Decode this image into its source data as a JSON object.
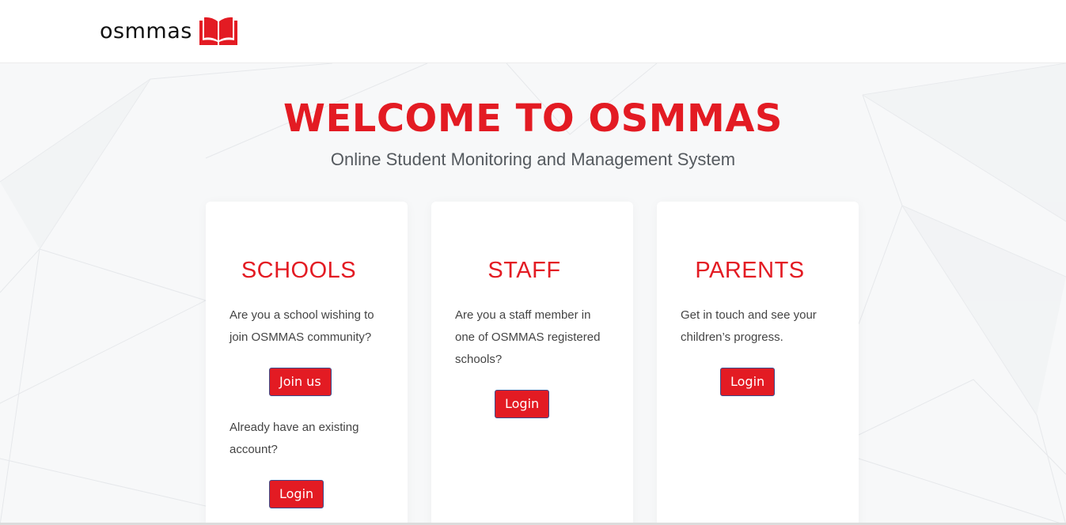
{
  "header": {
    "logo_text": "osmmas",
    "logo_icon": "open-book-icon"
  },
  "hero": {
    "title": "WELCOME TO OSMMAS",
    "subtitle": "Online Student Monitoring and Management System"
  },
  "cards": {
    "schools": {
      "title": "SCHOOLS",
      "text": "Are you a school wishing to join OSMMAS community?",
      "join_label": "Join us",
      "existing_text": "Already have an existing account?",
      "login_label": "Login"
    },
    "staff": {
      "title": "STAFF",
      "text": "Are you a staff member in one of OSMMAS registered schools?",
      "login_label": "Login"
    },
    "parents": {
      "title": "PARENTS",
      "text": "Get in touch and see your children’s progress.",
      "login_label": "Login"
    }
  },
  "colors": {
    "accent": "#e31b23",
    "button_border": "#3b4c8c",
    "text": "#444444",
    "subtitle": "#555a5f",
    "hero_background": "#f7f8f9"
  }
}
